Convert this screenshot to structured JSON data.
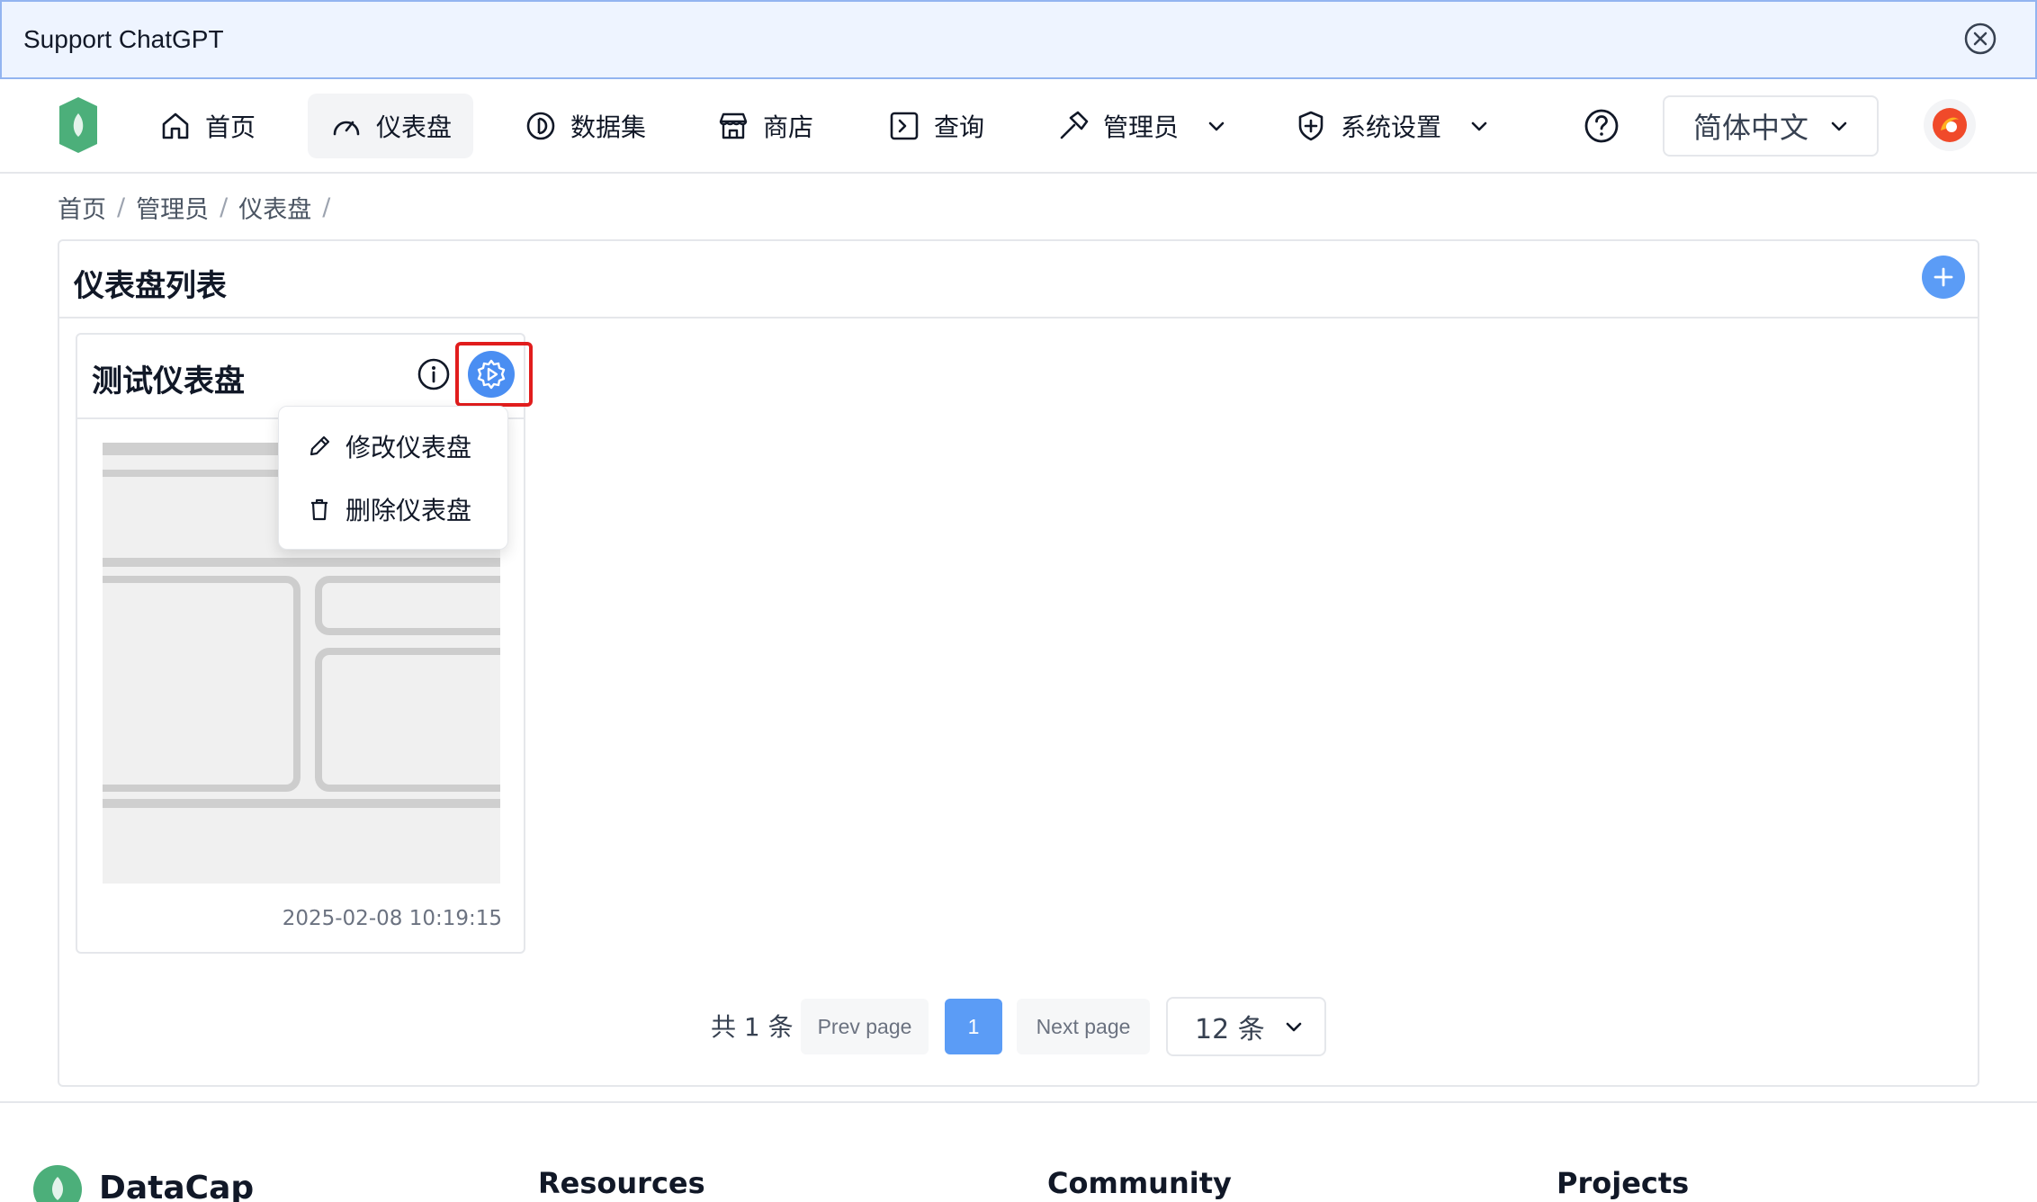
{
  "banner": {
    "text": "Support ChatGPT"
  },
  "nav": {
    "home": "首页",
    "dashboard": "仪表盘",
    "dataset": "数据集",
    "store": "商店",
    "query": "查询",
    "admin": "管理员",
    "settings": "系统设置",
    "language": "简体中文"
  },
  "breadcrumb": {
    "items": [
      "首页",
      "管理员",
      "仪表盘"
    ]
  },
  "main": {
    "title": "仪表盘列表"
  },
  "dashboard_card": {
    "title": "测试仪表盘",
    "date": "2025-02-08 10:19:15"
  },
  "menu": {
    "edit": "修改仪表盘",
    "delete": "删除仪表盘"
  },
  "pagination": {
    "total": "共 1 条",
    "prev": "Prev page",
    "current": "1",
    "next": "Next page",
    "page_size": "12 条"
  },
  "footer": {
    "brand": "DataCap",
    "columns": [
      "Resources",
      "Community",
      "Projects"
    ]
  },
  "colors": {
    "accent": "#4a8ef2",
    "highlight": "#e11d1d",
    "logo": "#4caf7a"
  },
  "icons": [
    "close-icon",
    "home-icon",
    "gauge-icon",
    "dataset-icon",
    "store-icon",
    "terminal-icon",
    "hammer-icon",
    "shield-icon",
    "help-icon",
    "info-icon",
    "gear-icon",
    "plus-icon",
    "pencil-icon",
    "trash-icon",
    "chevron-down-icon"
  ]
}
